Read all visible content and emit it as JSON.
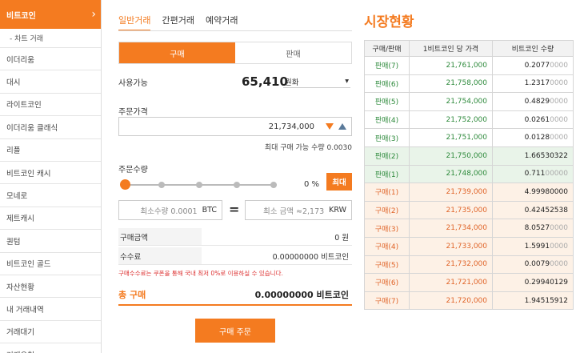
{
  "sidebar": {
    "active": "비트코인",
    "sub": "- 차트 거래",
    "items": [
      "이더리움",
      "대시",
      "라이트코인",
      "이더리움 클래식",
      "리플",
      "비트코인 캐시",
      "모네로",
      "제트캐시",
      "퀀텀",
      "비트코인 골드",
      "자산현황",
      "내 거래내역",
      "거래대기",
      "거래요청"
    ]
  },
  "trade": {
    "tabs": [
      "일반거래",
      "간편거래",
      "예약거래"
    ],
    "buy_tab": "구매",
    "sell_tab": "판매",
    "available_label": "사용가능",
    "available_amount": "65,410",
    "currency": "원화",
    "price_label": "주문가격",
    "price_value": "21,734,000",
    "max_buy_note": "최대 구매 가능 수량 0.0030",
    "qty_label": "주문수량",
    "qty_percent": "0 %",
    "max_label": "최대",
    "slider_fraction": 0,
    "min_qty_label": "최소수량 0.0001",
    "min_qty_unit": "BTC",
    "min_amount_label": "최소 금액 ≈2,173",
    "min_amount_unit": "KRW",
    "amount_label": "구매금액",
    "amount_value": "0 원",
    "fee_label": "수수료",
    "fee_value": "0.00000000 비트코인",
    "fee_note": "구매수수료는 쿠폰을 통해 국내 최저 0%로 이용하실 수 있습니다.",
    "total_label": "총 구매",
    "total_value": "0.00000000 비트코인",
    "order_button": "구매 주문"
  },
  "market": {
    "title": "시장현황",
    "headers": [
      "구매/판매",
      "1비트코인 당 가격",
      "비트코인 수량"
    ],
    "sells": [
      {
        "label": "판매(7)",
        "price": "21,761,000",
        "qty_strong": "0.2077",
        "qty_faint": "0000"
      },
      {
        "label": "판매(6)",
        "price": "21,758,000",
        "qty_strong": "1.2317",
        "qty_faint": "0000"
      },
      {
        "label": "판매(5)",
        "price": "21,754,000",
        "qty_strong": "0.4829",
        "qty_faint": "0000"
      },
      {
        "label": "판매(4)",
        "price": "21,752,000",
        "qty_strong": "0.0261",
        "qty_faint": "0000"
      },
      {
        "label": "판매(3)",
        "price": "21,751,000",
        "qty_strong": "0.0128",
        "qty_faint": "0000"
      },
      {
        "label": "판매(2)",
        "price": "21,750,000",
        "qty_strong": "1.66530322",
        "qty_faint": ""
      },
      {
        "label": "판매(1)",
        "price": "21,748,000",
        "qty_strong": "0.711",
        "qty_faint": "00000"
      }
    ],
    "buys": [
      {
        "label": "구매(1)",
        "price": "21,739,000",
        "qty_strong": "4.99980000",
        "qty_faint": ""
      },
      {
        "label": "구매(2)",
        "price": "21,735,000",
        "qty_strong": "0.42452538",
        "qty_faint": ""
      },
      {
        "label": "구매(3)",
        "price": "21,734,000",
        "qty_strong": "8.0527",
        "qty_faint": "0000"
      },
      {
        "label": "구매(4)",
        "price": "21,733,000",
        "qty_strong": "1.5991",
        "qty_faint": "0000"
      },
      {
        "label": "구매(5)",
        "price": "21,732,000",
        "qty_strong": "0.0079",
        "qty_faint": "0000"
      },
      {
        "label": "구매(6)",
        "price": "21,721,000",
        "qty_strong": "0.29940129",
        "qty_faint": ""
      },
      {
        "label": "구매(7)",
        "price": "21,720,000",
        "qty_strong": "1.94515912",
        "qty_faint": ""
      }
    ]
  }
}
